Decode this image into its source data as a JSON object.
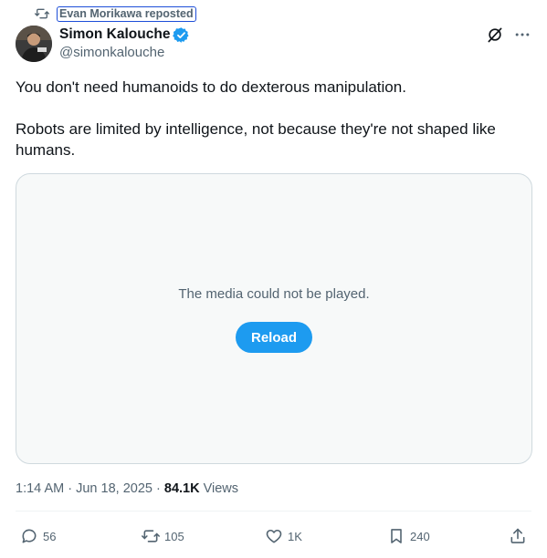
{
  "repost": {
    "label": "Evan Morikawa reposted",
    "icon": "retweet-icon"
  },
  "author": {
    "name": "Simon Kalouche",
    "handle": "@simonkalouche",
    "verified": true,
    "avatar_icon": "avatar"
  },
  "tweet": {
    "line1": "You don't need humanoids to do dexterous manipulation.",
    "line2": "Robots are limited by intelligence, not because they're not shaped like humans."
  },
  "media": {
    "message": "The media could not be played.",
    "reload_label": "Reload"
  },
  "meta": {
    "time": "1:14 AM",
    "separator": "·",
    "date": "Jun 18, 2025",
    "views_count": "84.1K",
    "views_label": "Views"
  },
  "actions": {
    "replies": "56",
    "reposts": "105",
    "likes": "1K",
    "bookmarks": "240"
  },
  "colors": {
    "accent": "#1d9bf0",
    "secondary_text": "#536471",
    "primary_text": "#0f1419",
    "media_bg": "#f7f9f9",
    "border": "#cfd9de"
  }
}
